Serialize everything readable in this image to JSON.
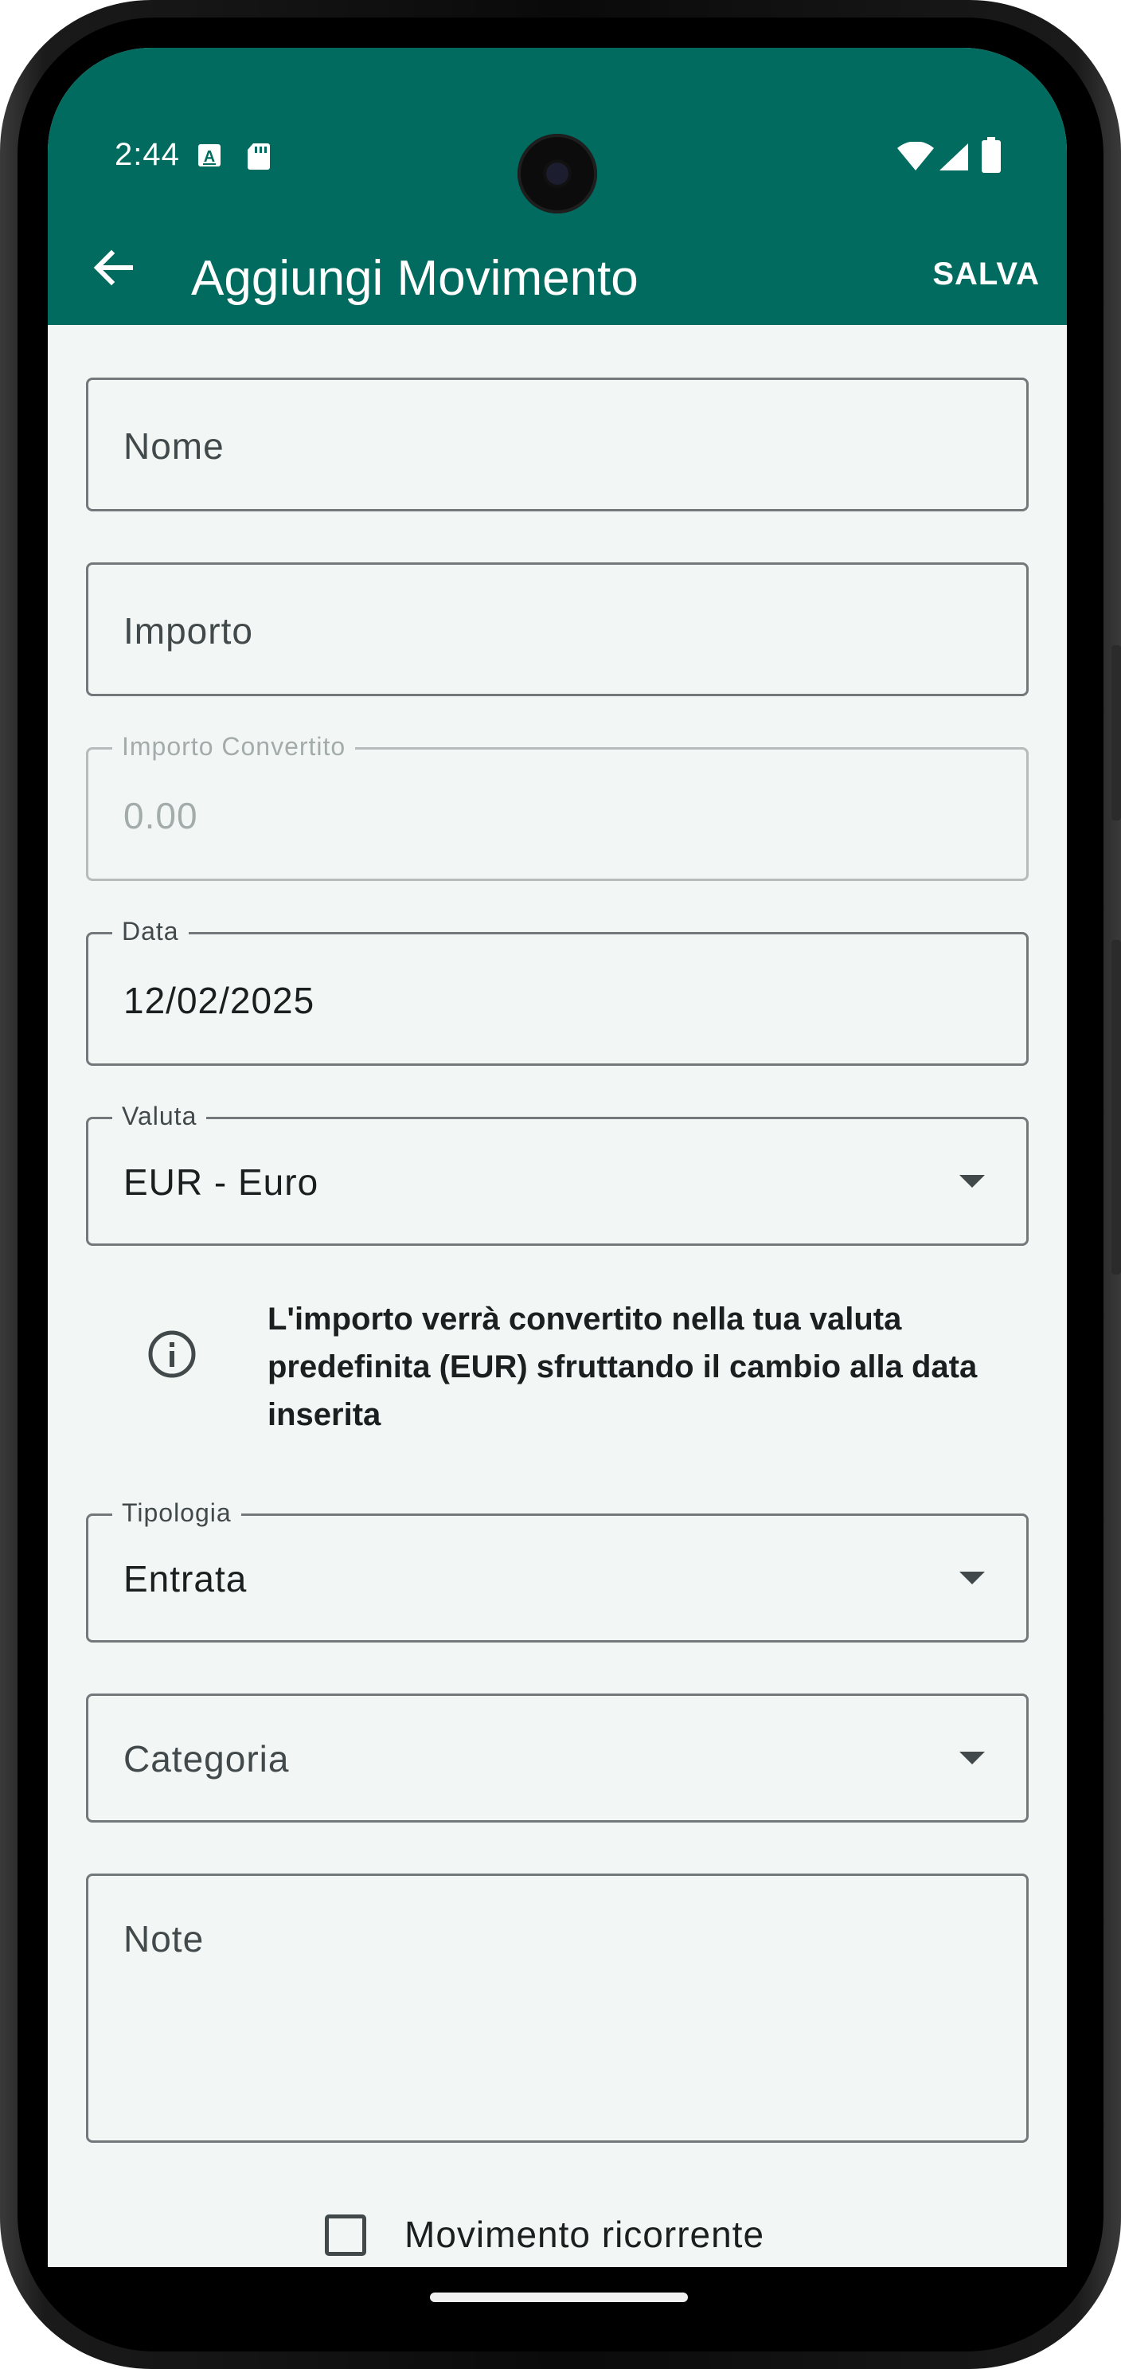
{
  "status_bar": {
    "time": "2:44",
    "left_icons": [
      "text-recognition-icon",
      "sd-card-icon"
    ],
    "right_icons": [
      "wifi-icon",
      "signal-icon",
      "battery-icon"
    ]
  },
  "app_bar": {
    "back_icon": "arrow-back-icon",
    "title": "Aggiungi Movimento",
    "action_label": "SALVA"
  },
  "form": {
    "nome": {
      "placeholder": "Nome"
    },
    "importo": {
      "placeholder": "Importo"
    },
    "importo_convertito": {
      "label": "Importo Convertito",
      "value": "0.00",
      "disabled": true
    },
    "data": {
      "label": "Data",
      "value": "12/02/2025"
    },
    "valuta": {
      "label": "Valuta",
      "value": "EUR - Euro"
    },
    "info_text": "L'importo verrà convertito nella tua valuta predefinita (EUR) sfruttando il cambio alla data inserita",
    "tipologia": {
      "label": "Tipologia",
      "value": "Entrata"
    },
    "categoria": {
      "placeholder": "Categoria"
    },
    "note": {
      "placeholder": "Note"
    },
    "ricorrente": {
      "label": "Movimento ricorrente",
      "checked": false
    }
  },
  "colors": {
    "app_bar": "#006b5e",
    "background": "#f2f7f5",
    "outline": "#73797a"
  }
}
